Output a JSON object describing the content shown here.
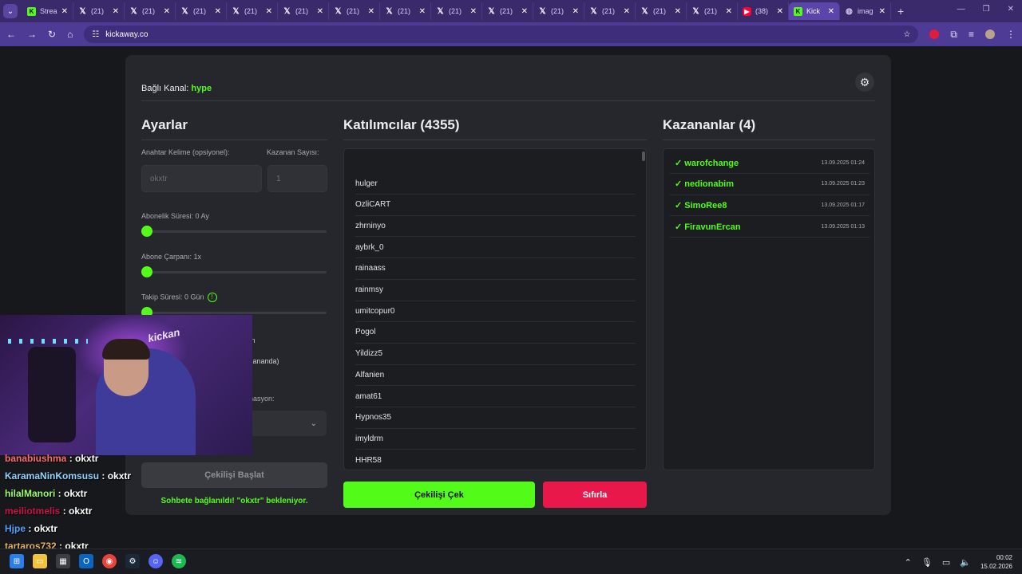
{
  "browser": {
    "tabs": [
      {
        "icon": "kick",
        "title": "Strea",
        "active": false
      },
      {
        "icon": "x",
        "title": "(21) ",
        "active": false
      },
      {
        "icon": "x",
        "title": "(21) ",
        "active": false
      },
      {
        "icon": "x",
        "title": "(21) ",
        "active": false
      },
      {
        "icon": "x",
        "title": "(21) ",
        "active": false
      },
      {
        "icon": "x",
        "title": "(21) ",
        "active": false
      },
      {
        "icon": "x",
        "title": "(21) ",
        "active": false
      },
      {
        "icon": "x",
        "title": "(21) ",
        "active": false
      },
      {
        "icon": "x",
        "title": "(21) ",
        "active": false
      },
      {
        "icon": "x",
        "title": "(21) ",
        "active": false
      },
      {
        "icon": "x",
        "title": "(21) ",
        "active": false
      },
      {
        "icon": "x",
        "title": "(21) ",
        "active": false
      },
      {
        "icon": "x",
        "title": "(21) ",
        "active": false
      },
      {
        "icon": "x",
        "title": "(21) ",
        "active": false
      },
      {
        "icon": "yt",
        "title": "(38) ",
        "active": false
      },
      {
        "icon": "kick",
        "title": "Kick",
        "active": true
      },
      {
        "icon": "globe",
        "title": "imag",
        "active": false
      }
    ],
    "url": "kickaway.co"
  },
  "header": {
    "label": "Bağlı Kanal:",
    "channel": "hype"
  },
  "settings": {
    "title": "Ayarlar",
    "keyword_label": "Anahtar Kelime (opsiyonel):",
    "keyword_placeholder": "okxtr",
    "winner_count_label": "Kazanan Sayısı:",
    "winner_count_placeholder": "1",
    "sub_duration_label": "Abonelik Süresi: 0 Ay",
    "sub_multiplier_label": "Abone Çarpanı: 1x",
    "follow_duration_label": "Takip Süresi: 0 Gün",
    "partial_1": "ın",
    "partial_2": "zananda)",
    "partial_3": "nasyon:",
    "select_value": "ark",
    "start_button": "Çekilişi Başlat",
    "status": "Sohbete bağlanıldı! \"okxtr\" bekleniyor."
  },
  "participants": {
    "title": "Katılımcılar (4355)",
    "items": [
      "hulger",
      "OzliCART",
      "zhrninyo",
      "aybrk_0",
      "rainaass",
      "rainmsy",
      "umitcopur0",
      "Pogol",
      "Yildizz5",
      "Alfanien",
      "amat61",
      "Hypnos35",
      "imyldrm",
      "HHR58"
    ],
    "draw_button": "Çekilişi Çek",
    "reset_button": "Sıfırla"
  },
  "winners": {
    "title": "Kazananlar (4)",
    "items": [
      {
        "name": "✓ warofchange",
        "time": "13.09.2025 01:24"
      },
      {
        "name": "✓ nedionabim",
        "time": "13.09.2025 01:23"
      },
      {
        "name": "✓ SimoRee8",
        "time": "13.09.2025 01:17"
      },
      {
        "name": "✓ FiravunErcan",
        "time": "13.09.2025 01:13"
      }
    ]
  },
  "overlay_chat": [
    {
      "user": "banabiushma",
      "text": " : okxtr",
      "color": "#ff6b6b"
    },
    {
      "user": "KaramaNinKomsusu",
      "text": " : okxtr",
      "color": "#8fd3ff"
    },
    {
      "user": "hilalManori",
      "text": " : okxtr",
      "color": "#9cff6b"
    },
    {
      "user": "meiliotmelis",
      "text": " : okxtr",
      "color": "#d0104a"
    },
    {
      "user": "Hjpe",
      "text": " : okxtr",
      "color": "#4aa3ff"
    },
    {
      "user": "tartaros732",
      "text": " : okxtr",
      "color": "#e3b25a"
    }
  ],
  "webcam": {
    "sign_text": "kickan"
  },
  "taskbar": {
    "time": "00:02",
    "date": "15.02.2026"
  },
  "colors": {
    "accent": "#53fc18",
    "danger": "#e8184a",
    "browser": "#4e3b96"
  }
}
